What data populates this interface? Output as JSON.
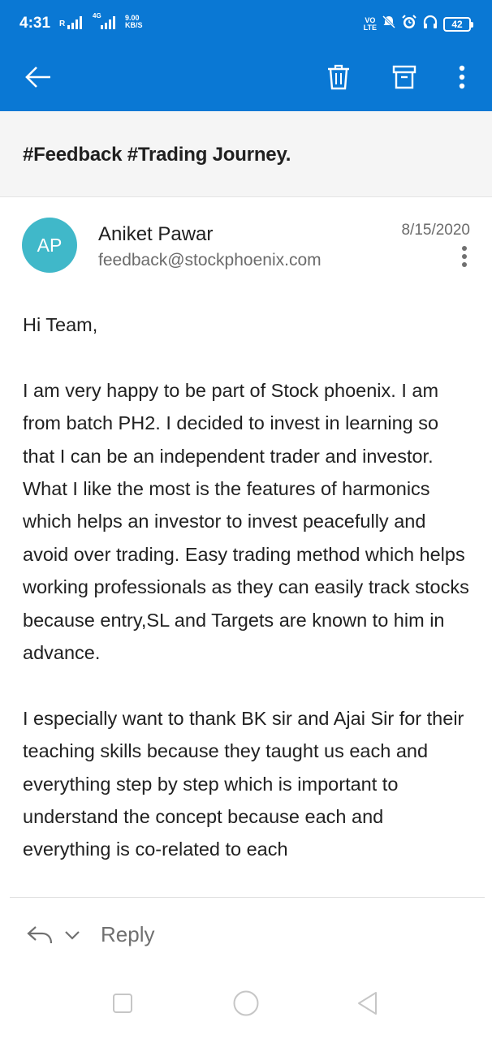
{
  "status_bar": {
    "time": "4:31",
    "signal_label": "R",
    "network_type": "4G",
    "speed_value": "9.00",
    "speed_unit": "KB/S",
    "volte_top": "VO",
    "volte_bottom": "LTE",
    "battery_level": "42",
    "icons": [
      "signal-bars-icon",
      "mute-icon",
      "alarm-icon",
      "headphones-icon",
      "battery-icon"
    ]
  },
  "toolbar": {
    "back_icon": "arrow-left-icon",
    "delete_icon": "trash-icon",
    "archive_icon": "archive-icon",
    "more_icon": "more-vertical-icon"
  },
  "email": {
    "subject": "#Feedback #Trading Journey.",
    "sender": {
      "initials": "AP",
      "name": "Aniket Pawar",
      "email": "feedback@stockphoenix.com",
      "avatar_color": "#40b8c9"
    },
    "date": "8/15/2020",
    "body": [
      "Hi Team,",
      "I am very happy to be part of Stock phoenix. I am from batch PH2. I decided to invest in learning so that I can be an independent trader and investor. What I like the most is the features of harmonics which helps an investor to invest peacefully and avoid over trading. Easy trading method which helps working professionals as they can easily track stocks because entry,SL and Targets are known to him in advance.",
      "I especially want to thank BK sir and Ajai Sir for their teaching skills because they taught us each and everything step by step which is important to understand the concept because each and everything is co-related to each"
    ]
  },
  "reply": {
    "label": "Reply",
    "icon": "reply-icon",
    "expand_icon": "chevron-down-icon"
  },
  "nav_bar": {
    "recents_icon": "square-icon",
    "home_icon": "circle-icon",
    "back_icon": "triangle-back-icon"
  },
  "colors": {
    "accent": "#0a78d4",
    "subject_background": "#f5f5f5"
  }
}
